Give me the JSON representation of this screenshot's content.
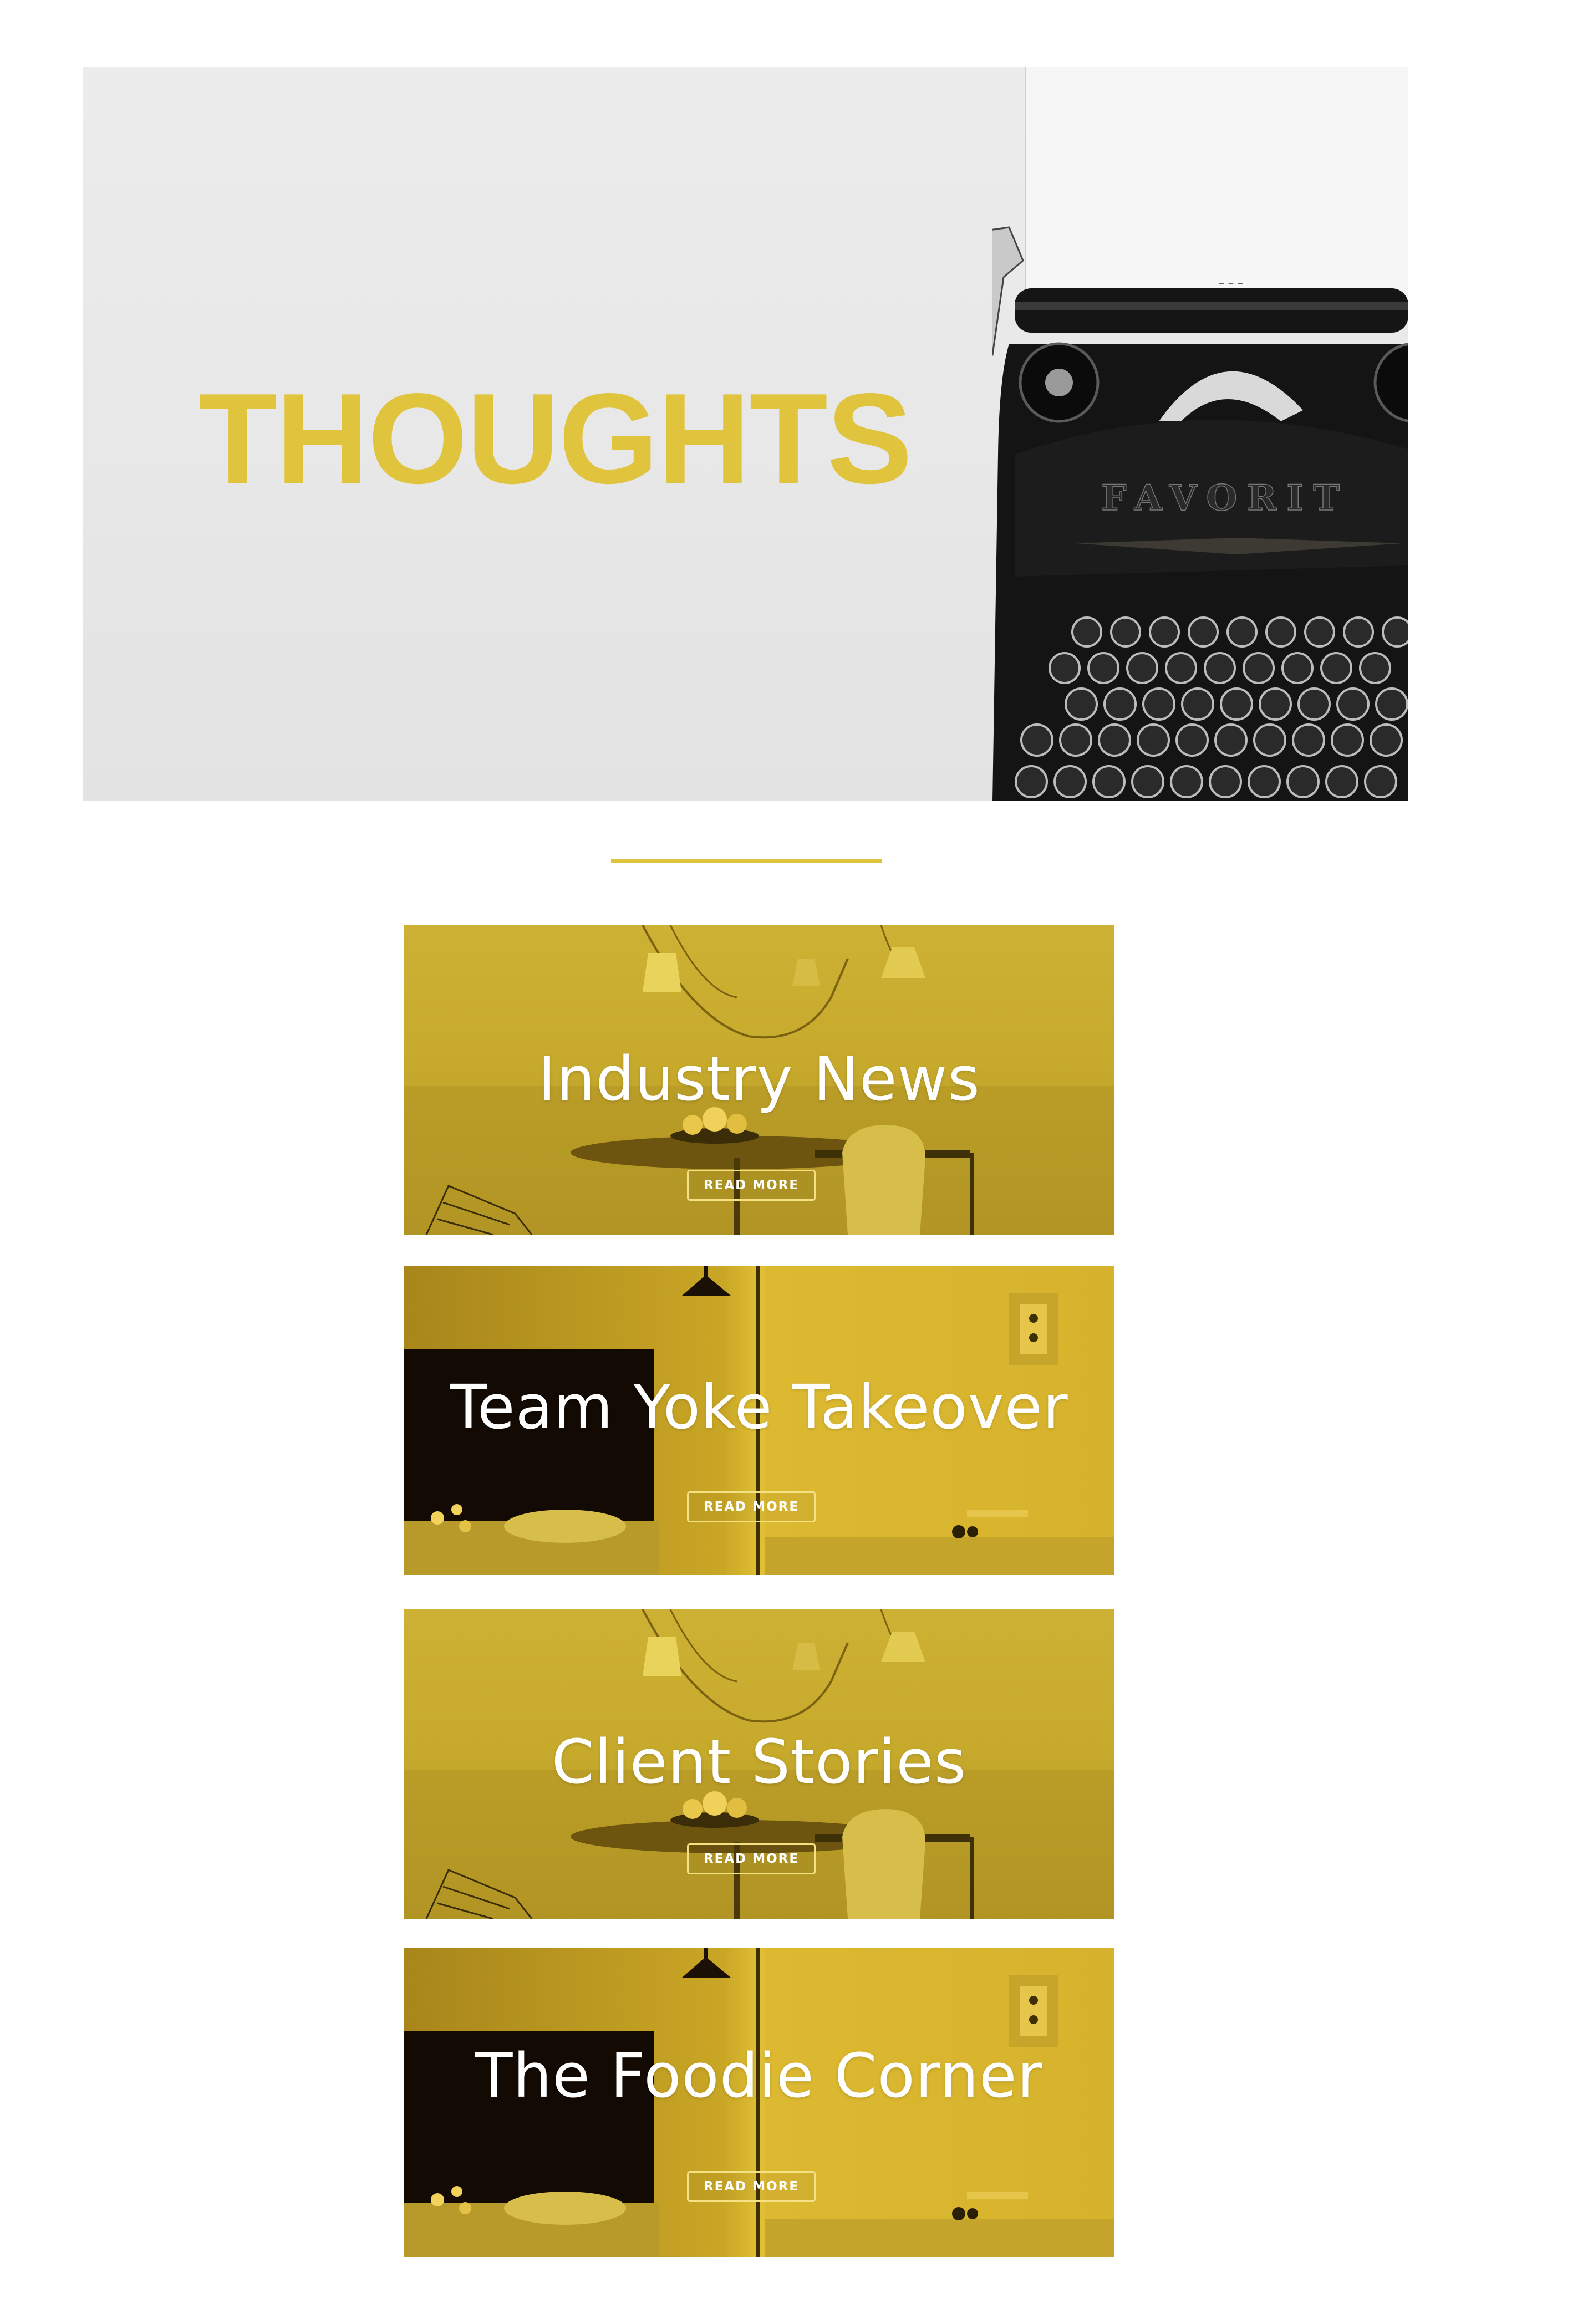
{
  "hero": {
    "title": "THOUGHTS",
    "image": "vintage-typewriter-photo",
    "accent_color": "#e1c43e"
  },
  "cards": [
    {
      "title": "Industry News",
      "button_label": "READ MORE",
      "image": "seaside-dining-room-photo"
    },
    {
      "title": "Team Yoke Takeover",
      "button_label": "READ MORE",
      "image": "interior-wall-lamp-photo"
    },
    {
      "title": "Client Stories",
      "button_label": "READ MORE",
      "image": "seaside-dining-room-photo"
    },
    {
      "title": "The Foodie Corner",
      "button_label": "READ MORE",
      "image": "interior-wall-lamp-photo"
    }
  ],
  "colors": {
    "accent": "#e1c43e",
    "card_overlay": "#d6b72e",
    "button_border": "#f4e183",
    "text_on_card": "#ffffff"
  }
}
